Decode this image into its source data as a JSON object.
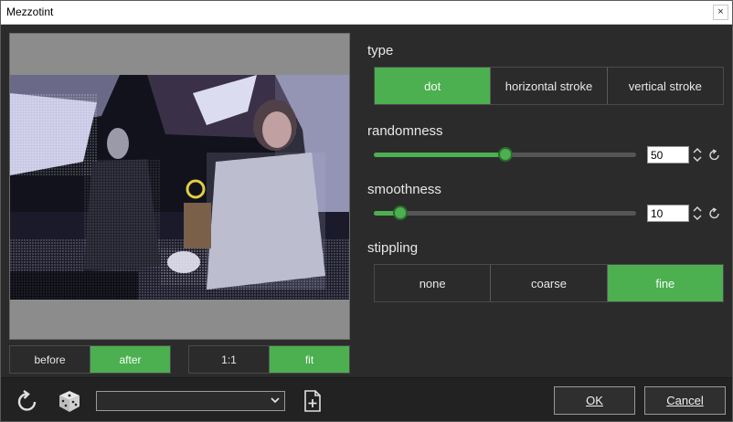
{
  "window": {
    "title": "Mezzotint",
    "close_glyph": "×"
  },
  "preview": {
    "view_toggle": [
      {
        "label": "before",
        "active": false
      },
      {
        "label": "after",
        "active": true
      }
    ],
    "zoom_toggle": [
      {
        "label": "1:1",
        "active": false
      },
      {
        "label": "fit",
        "active": true
      }
    ]
  },
  "controls": {
    "type": {
      "label": "type",
      "options": [
        {
          "label": "dot",
          "active": true
        },
        {
          "label": "horizontal stroke",
          "active": false
        },
        {
          "label": "vertical stroke",
          "active": false
        }
      ]
    },
    "randomness": {
      "label": "randomness",
      "value": "50",
      "min": 0,
      "max": 100
    },
    "smoothness": {
      "label": "smoothness",
      "value": "10",
      "min": 0,
      "max": 100
    },
    "stippling": {
      "label": "stippling",
      "options": [
        {
          "label": "none",
          "active": false
        },
        {
          "label": "coarse",
          "active": false
        },
        {
          "label": "fine",
          "active": true
        }
      ]
    }
  },
  "footer": {
    "preset_value": "",
    "ok_label": "OK",
    "cancel_label": "Cancel",
    "icons": [
      "reset-icon",
      "dice-icon",
      "chevron-down-icon",
      "new-preset-icon"
    ]
  },
  "colors": {
    "accent": "#4caf50",
    "background": "#2b2b2b",
    "footer": "#222222"
  }
}
